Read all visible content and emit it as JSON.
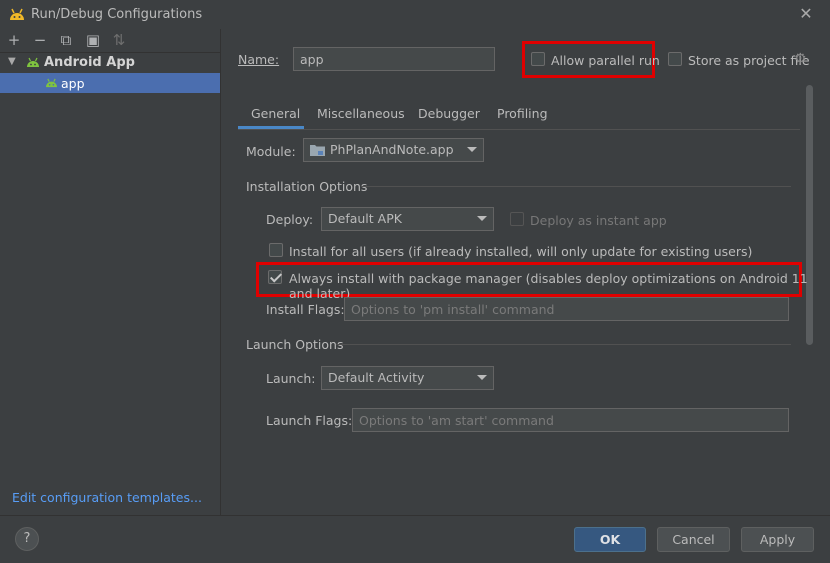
{
  "window": {
    "title": "Run/Debug Configurations",
    "close_glyph": "✕"
  },
  "toolbar": {
    "add": "+",
    "remove": "−",
    "copy": "⧉",
    "folder": "▣",
    "sort": "⇅"
  },
  "tree": {
    "parent_label": "Android App",
    "child_label": "app"
  },
  "edit_templates": "Edit configuration templates...",
  "name_field": {
    "label": "Name:",
    "value": "app"
  },
  "allow_parallel": {
    "label": "Allow parallel run",
    "checked": false
  },
  "store_project": {
    "label": "Store as project file",
    "checked": false,
    "gear_glyph": "⚙"
  },
  "tabs": [
    {
      "label": "General",
      "active": true
    },
    {
      "label": "Miscellaneous",
      "active": false
    },
    {
      "label": "Debugger",
      "active": false
    },
    {
      "label": "Profiling",
      "active": false
    }
  ],
  "module": {
    "label": "Module:",
    "value": "PhPlanAndNote.app"
  },
  "installation": {
    "title": "Installation Options",
    "deploy_label": "Deploy:",
    "deploy_value": "Default APK",
    "instant_label": "Deploy as instant app",
    "all_users_label": "Install for all users (if already installed, will only update for existing users)",
    "pkg_manager_label": "Always install with package manager (disables deploy optimizations on Android 11 and later)",
    "pkg_manager_checked": true,
    "flags_label": "Install Flags:",
    "flags_placeholder": "Options to 'pm install' command"
  },
  "launch": {
    "title": "Launch Options",
    "launch_label": "Launch:",
    "launch_value": "Default Activity",
    "flags_label": "Launch Flags:",
    "flags_placeholder": "Options to 'am start' command"
  },
  "buttons": {
    "help": "?",
    "ok": "OK",
    "cancel": "Cancel",
    "apply": "Apply"
  },
  "colors": {
    "highlight": "#e00000",
    "accent": "#4a88c7",
    "selection": "#4b6eaf",
    "android_green": "#7fc43f"
  }
}
